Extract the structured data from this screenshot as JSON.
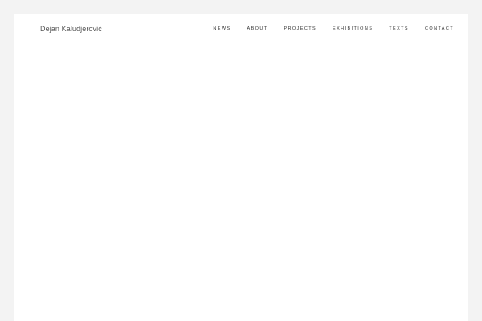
{
  "site": {
    "title": "Dejan Kaludjerović"
  },
  "nav": {
    "items": [
      {
        "label": "NEWS"
      },
      {
        "label": "ABOUT"
      },
      {
        "label": "PROJECTS"
      },
      {
        "label": "EXHIBITIONS"
      },
      {
        "label": "TEXTS"
      },
      {
        "label": "CONTACT"
      }
    ]
  },
  "colors": {
    "background": "#f3f3f3",
    "page": "#ffffff",
    "text": "#333333"
  }
}
